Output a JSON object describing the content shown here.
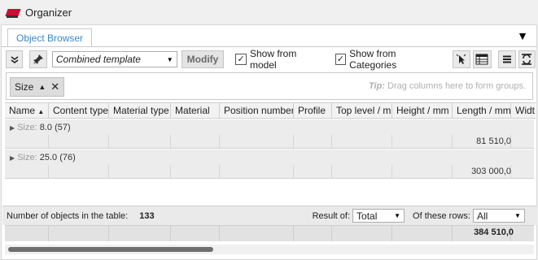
{
  "window": {
    "title": "Organizer"
  },
  "tabs": {
    "active": "Object Browser",
    "menu_glyph": "▼"
  },
  "toolbar": {
    "template_value": "Combined template",
    "modify_label": "Modify",
    "show_from_model_label": "Show from model",
    "show_from_model_checked": "✓",
    "show_from_categories_label": "Show from Categories",
    "show_from_categories_checked": "✓",
    "icons": [
      "collapse-icon",
      "pin-icon",
      "select-objects-icon",
      "table-view-icon",
      "list-menu-icon",
      "refresh-icon"
    ]
  },
  "grouping": {
    "chip_label": "Size",
    "tip_prefix": "Tip:",
    "tip_text": "Drag columns here to form groups."
  },
  "columns": [
    "Name",
    "Content type",
    "Material type",
    "Material",
    "Position number",
    "Profile",
    "Top level / m",
    "Height / mm",
    "Length / mm",
    "Widt"
  ],
  "groups": [
    {
      "key": "Size:",
      "value": "8.0 (57)",
      "length_sum": "81 510,0"
    },
    {
      "key": "Size:",
      "value": "25.0 (76)",
      "length_sum": "303 000,0"
    }
  ],
  "summary": {
    "objects_label": "Number of objects in the table:",
    "objects_count": "133",
    "result_of_label": "Result of:",
    "result_of_value": "Total",
    "these_rows_label": "Of these rows:",
    "these_rows_value": "All",
    "length_total": "384 510,0"
  },
  "colors": {
    "tab_text": "#3b87c8",
    "app_icon": "#c8102e"
  }
}
